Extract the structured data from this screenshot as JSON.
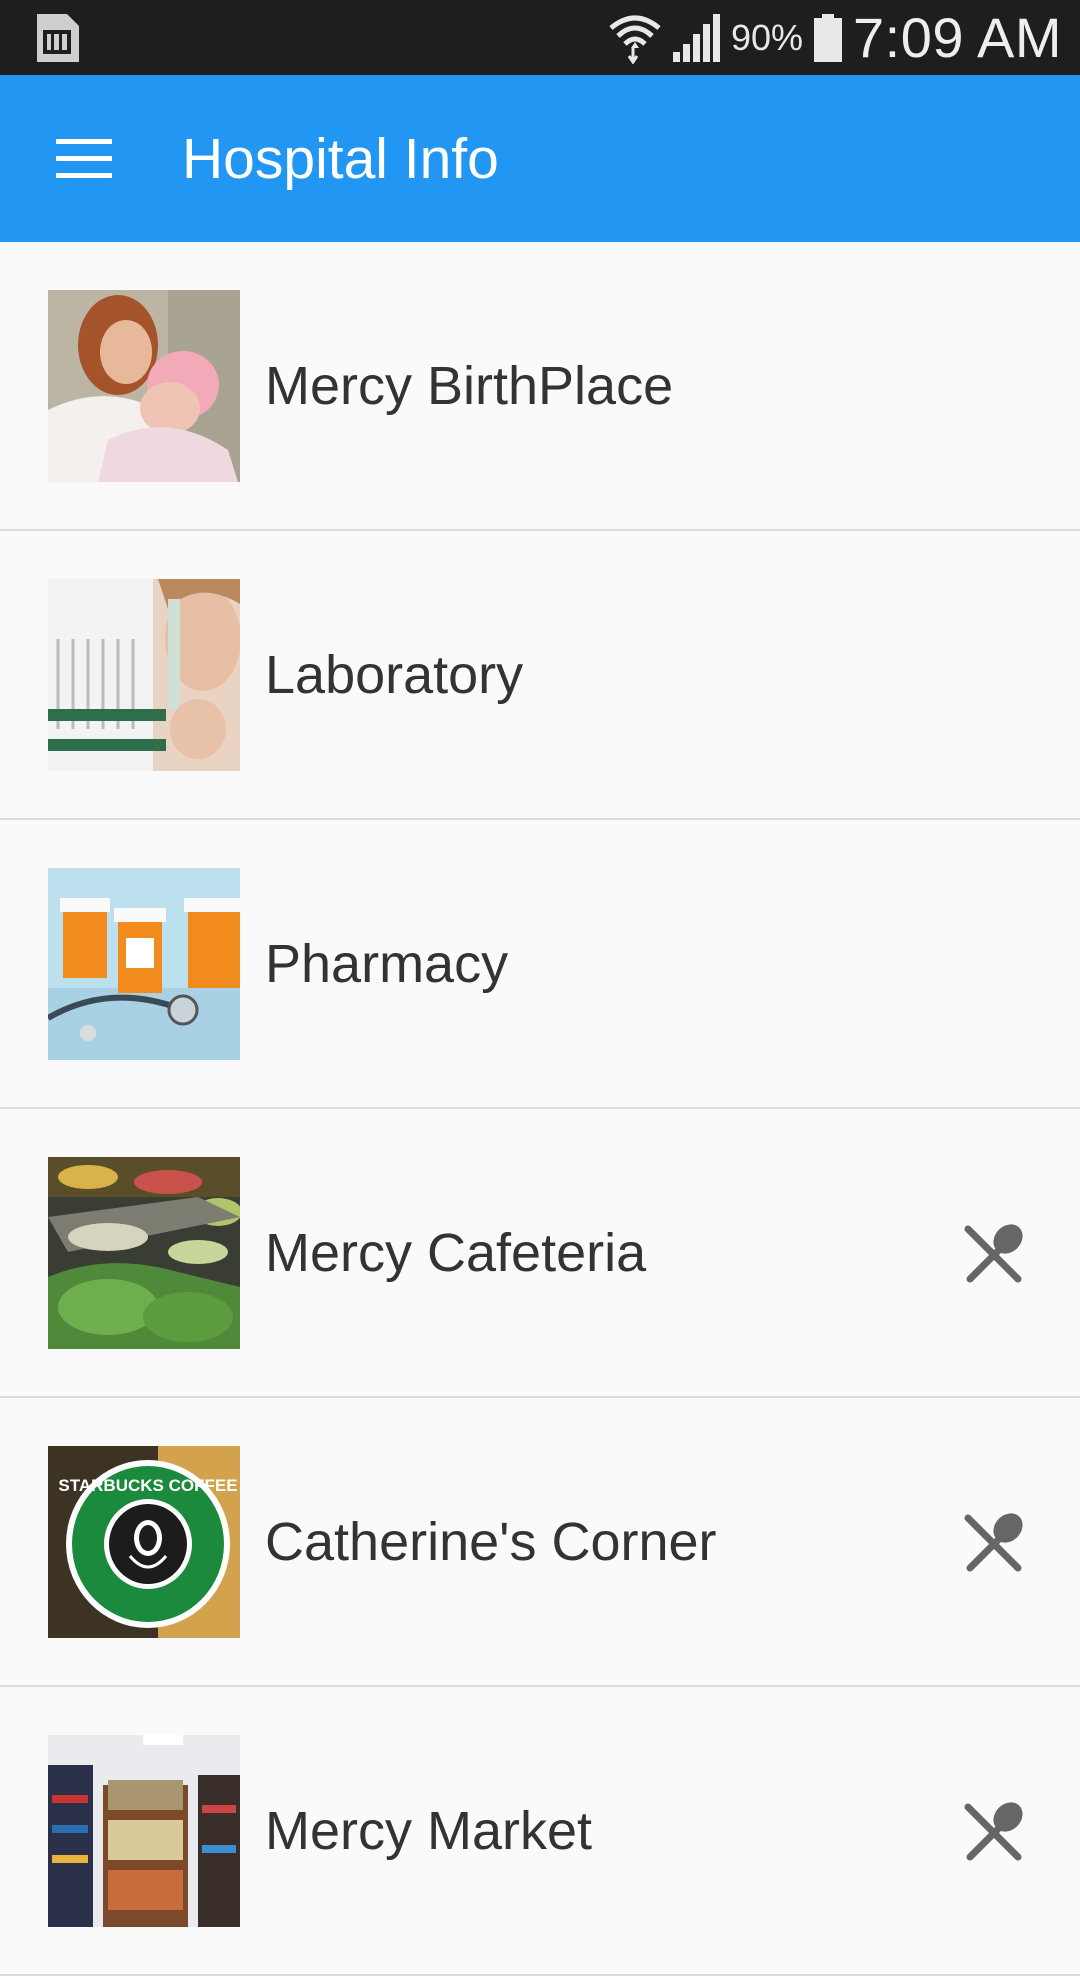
{
  "status_bar": {
    "battery_percent": "90%",
    "time": "7:09 AM",
    "icons": [
      "sim-card-icon",
      "wifi-icon",
      "signal-icon",
      "battery-icon"
    ]
  },
  "app_bar": {
    "title": "Hospital Info",
    "menu_icon": "hamburger-menu-icon",
    "color": "#2196F3"
  },
  "items": [
    {
      "label": "Mercy BirthPlace",
      "image": "mother-and-newborn-photo",
      "icon": null
    },
    {
      "label": "Laboratory",
      "image": "lab-technician-test-tubes-photo",
      "icon": null
    },
    {
      "label": "Pharmacy",
      "image": "pill-bottles-stethoscope-photo",
      "icon": null
    },
    {
      "label": "Mercy Cafeteria",
      "image": "salad-bar-photo",
      "icon": "dining-utensils-icon"
    },
    {
      "label": "Catherine's Corner",
      "image": "starbucks-coffee-sign-photo",
      "icon": "dining-utensils-icon",
      "image_text": "STARBUCKS COFFEE"
    },
    {
      "label": "Mercy Market",
      "image": "market-snack-shelves-photo",
      "icon": "dining-utensils-icon"
    }
  ]
}
